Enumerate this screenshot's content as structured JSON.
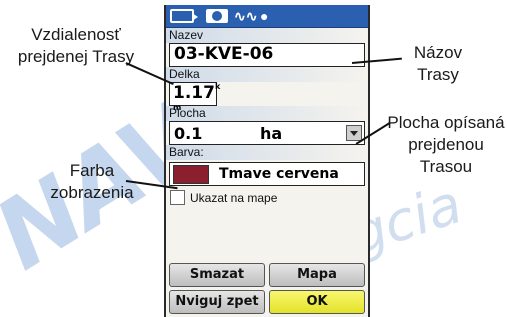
{
  "annotations": {
    "distance": [
      "Vzdialenosť",
      "prejdenej Trasy"
    ],
    "name": [
      "Názov",
      "Trasy"
    ],
    "area": [
      "Plocha opísaná",
      "prejdenou",
      "Trasou"
    ],
    "color": [
      "Farba",
      "zobrazenia"
    ]
  },
  "watermark": {
    "main": "NAV",
    "sub": "gcia"
  },
  "form": {
    "name_label": "Nazev",
    "name_value": "03-KVE-06",
    "length_label": "Delka",
    "length_value": "1.17",
    "length_unit_top": "k",
    "length_unit_bottom": "m",
    "area_label": "Plocha",
    "area_value": "0.1",
    "area_unit": "ha",
    "color_label": "Barva:",
    "color_value": "Tmave cervena",
    "color_hex": "#8a1f2e",
    "show_on_map_label": "Ukazat na mape"
  },
  "buttons": {
    "delete": "Smazat",
    "map": "Mapa",
    "navigate_back": "Nviguj zpet",
    "ok": "OK"
  },
  "icons": [
    "track-icon",
    "satellite-icon",
    "wave-icon",
    "bulb-icon"
  ]
}
